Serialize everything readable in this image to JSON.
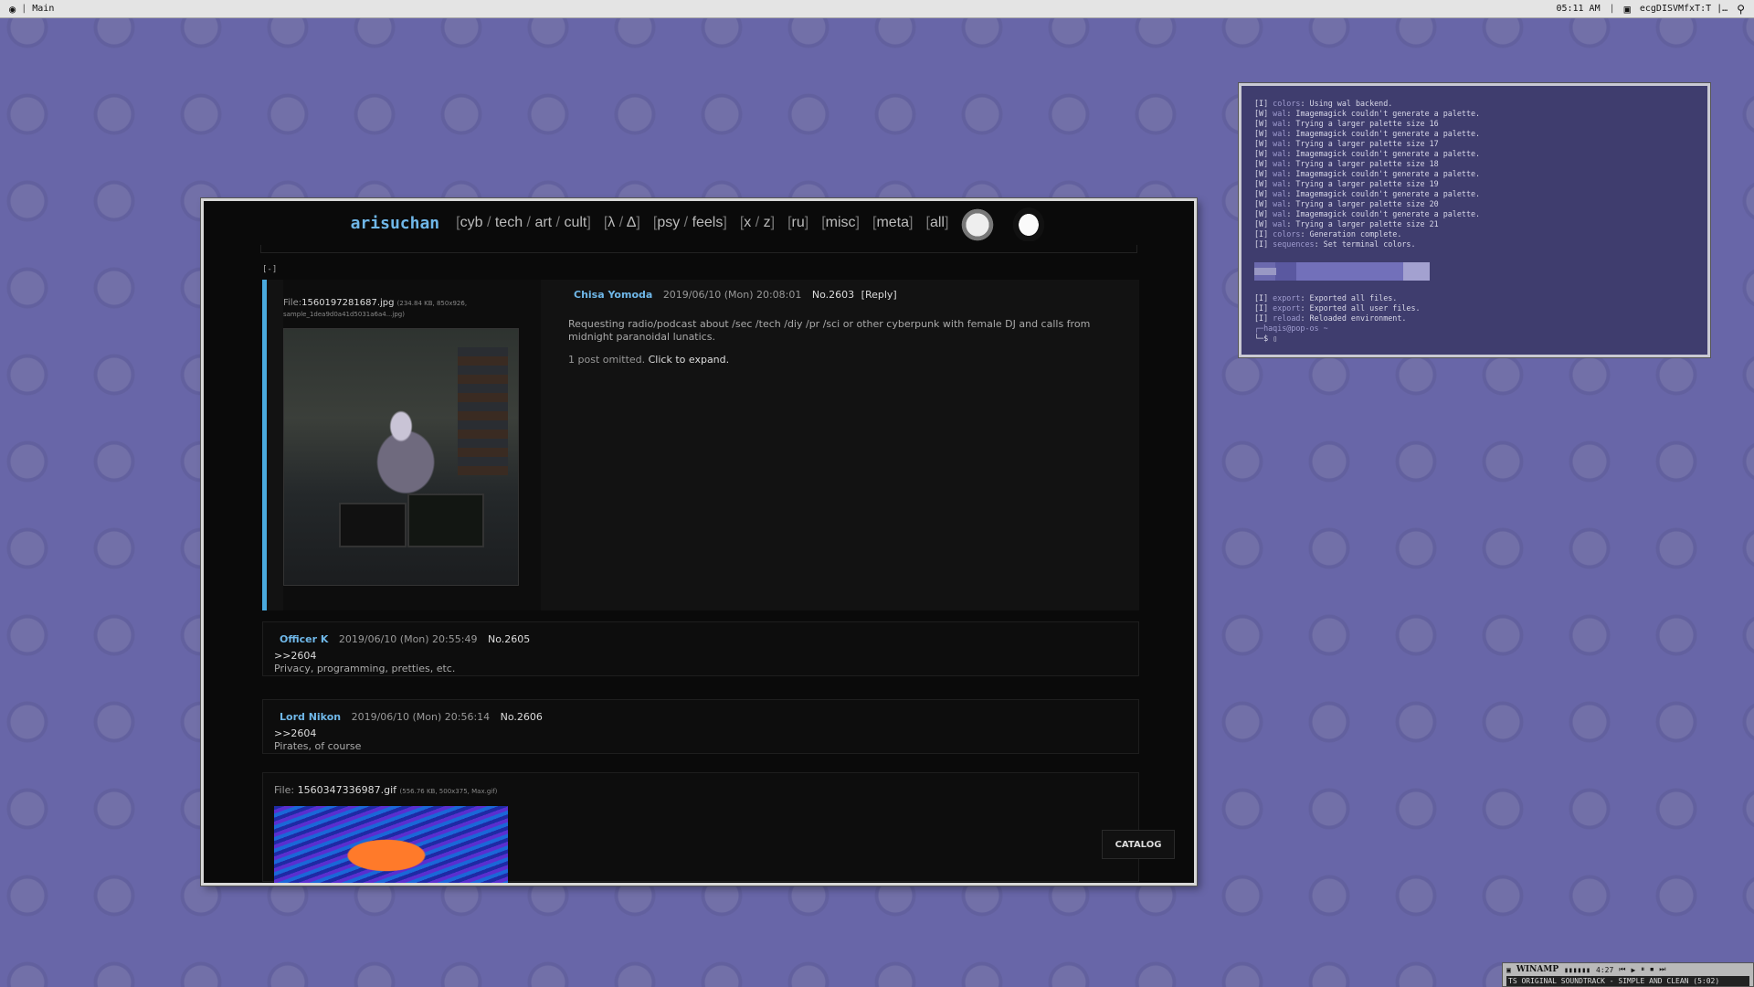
{
  "topbar": {
    "workspace": "Main",
    "time": "05:11 AM",
    "window_title": "ecgDISVMfxT:T |…"
  },
  "site": {
    "title": "arisuchan",
    "nav_groups": [
      [
        "cyb",
        "tech",
        "art",
        "cult"
      ],
      [
        "λ",
        "Δ"
      ],
      [
        "psy",
        "feels"
      ],
      [
        "x",
        "z"
      ],
      [
        "ru"
      ],
      [
        "misc"
      ],
      [
        "meta"
      ],
      [
        "all"
      ]
    ],
    "collapse": "[-]"
  },
  "op": {
    "file_label": "File:",
    "file_name": "1560197281687.jpg",
    "file_meta": "(234.84 KB, 850x926,",
    "file_meta2": "sample_1dea9d0a41d5031a6a4...jpg)",
    "name": "Chisa Yomoda",
    "date": "2019/06/10 (Mon) 20:08:01",
    "number": "No.2603",
    "reply_link": "[Reply]",
    "text": "Requesting radio/podcast about /sec /tech /diy /pr /sci or other cyberpunk with female DJ and calls from midnight paranoidal lunatics.",
    "omitted": "1 post omitted.",
    "expand": "Click to expand."
  },
  "replies": [
    {
      "name": "Officer K",
      "date": "2019/06/10 (Mon) 20:55:49",
      "number": "No.2605",
      "quote": ">>2604",
      "text": "Privacy, programming, pretties, etc."
    },
    {
      "name": "Lord Nikon",
      "date": "2019/06/10 (Mon) 20:56:14",
      "number": "No.2606",
      "quote": ">>2604",
      "text": "Pirates, of course"
    }
  ],
  "post3": {
    "file_label": "File:",
    "file_name": "1560347336987.gif",
    "file_meta": "(556.76 KB, 500x375, Max.gif)"
  },
  "catalog_label": "CATALOG",
  "terminal": {
    "lines": [
      [
        "[I]",
        "colors",
        "Using wal backend."
      ],
      [
        "[W]",
        "wal",
        "Imagemagick couldn't generate a palette."
      ],
      [
        "[W]",
        "wal",
        "Trying a larger palette size 16"
      ],
      [
        "[W]",
        "wal",
        "Imagemagick couldn't generate a palette."
      ],
      [
        "[W]",
        "wal",
        "Trying a larger palette size 17"
      ],
      [
        "[W]",
        "wal",
        "Imagemagick couldn't generate a palette."
      ],
      [
        "[W]",
        "wal",
        "Trying a larger palette size 18"
      ],
      [
        "[W]",
        "wal",
        "Imagemagick couldn't generate a palette."
      ],
      [
        "[W]",
        "wal",
        "Trying a larger palette size 19"
      ],
      [
        "[W]",
        "wal",
        "Imagemagick couldn't generate a palette."
      ],
      [
        "[W]",
        "wal",
        "Trying a larger palette size 20"
      ],
      [
        "[W]",
        "wal",
        "Imagemagick couldn't generate a palette."
      ],
      [
        "[W]",
        "wal",
        "Trying a larger palette size 21"
      ],
      [
        "[I]",
        "colors",
        "Generation complete."
      ],
      [
        "[I]",
        "sequences",
        "Set terminal colors."
      ]
    ],
    "lines2": [
      [
        "[I]",
        "export",
        "Exported all files."
      ],
      [
        "[I]",
        "export",
        "Exported all user files."
      ],
      [
        "[I]",
        "reload",
        "Reloaded environment."
      ]
    ],
    "prompt_user": "haqis@pop-os ~",
    "prompt": "└─$ ▯"
  },
  "winamp": {
    "brand": "WINAMP",
    "time": "4:27",
    "track": "TS ORIGINAL SOUNDTRACK - SIMPLE AND CLEAN (5:02)"
  },
  "colors": {
    "desktop": "#6866a8",
    "accent": "#6fb7e8",
    "op_border": "#4aa9de",
    "terminal_bg": "#3f3d6e"
  }
}
